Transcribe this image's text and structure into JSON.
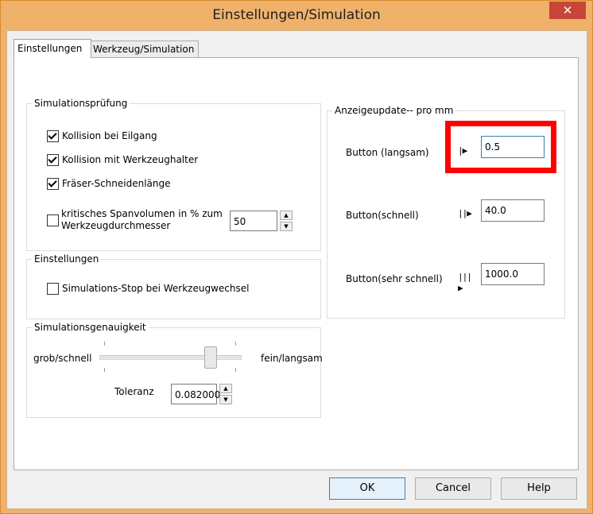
{
  "window": {
    "title": "Einstellungen/Simulation",
    "close_glyph": "✕"
  },
  "tabs": [
    {
      "label": "Einstellungen",
      "active": true
    },
    {
      "label": "Werkzeug/Simulation",
      "active": false
    }
  ],
  "simulation_check": {
    "title": "Simulationsprüfung",
    "options": [
      {
        "label": "Kollision bei Eilgang",
        "checked": true
      },
      {
        "label": "Kollision mit Werkzeughalter",
        "checked": true
      },
      {
        "label": "Fräser-Schneidenlänge",
        "checked": true
      }
    ],
    "volume_option": {
      "label_line1": "kritisches Spanvolumen in % zum",
      "label_line2": "Werkzeugdurchmesser",
      "checked": false,
      "value": "50"
    }
  },
  "settings_group": {
    "title": "Einstellungen",
    "stop_option": {
      "label": "Simulations-Stop bei Werkzeugwechsel",
      "checked": false
    }
  },
  "accuracy_group": {
    "title": "Simulationsgenauigkeit",
    "left_label": "grob/schnell",
    "right_label": "fein/langsam",
    "slider_level": 0.75,
    "tolerance_label": "Toleranz",
    "tolerance_value": "0.082000"
  },
  "display_update": {
    "title": "Anzeigeupdate-- pro mm",
    "rows": [
      {
        "label": "Button (langsam)",
        "value": "0.5",
        "icon": "slow-speed-icon",
        "glyph": "|▶"
      },
      {
        "label": "Button(schnell)",
        "value": "40.0",
        "icon": "fast-speed-icon",
        "glyph": "||▶"
      },
      {
        "label": "Button(sehr schnell)",
        "value": "1000.0",
        "icon": "very-fast-speed-icon",
        "glyph": "|||▶"
      }
    ],
    "highlight_color": "#ff0000"
  },
  "buttons": {
    "ok": "OK",
    "cancel": "Cancel",
    "help": "Help"
  }
}
